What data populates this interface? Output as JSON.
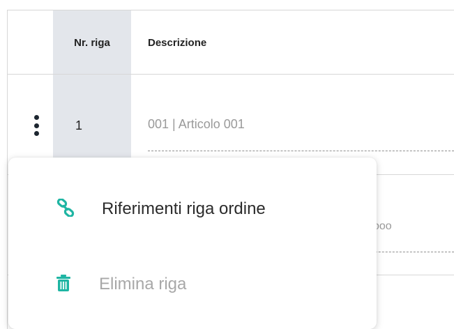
{
  "table": {
    "headers": {
      "nr": "Nr. riga",
      "description": "Descrizione"
    },
    "rows": [
      {
        "nr": "1",
        "description": "001 | Articolo 001"
      }
    ],
    "row2_partial_text": "ooo"
  },
  "context_menu": {
    "items": [
      {
        "label": "Riferimenti riga ordine",
        "icon": "link-icon",
        "enabled": true
      },
      {
        "label": "Elimina riga",
        "icon": "trash-icon",
        "enabled": false
      }
    ]
  },
  "colors": {
    "accent": "#1fb5a3",
    "nr_column_bg": "#e3e6eb",
    "disabled_text": "#a8a8a8"
  }
}
